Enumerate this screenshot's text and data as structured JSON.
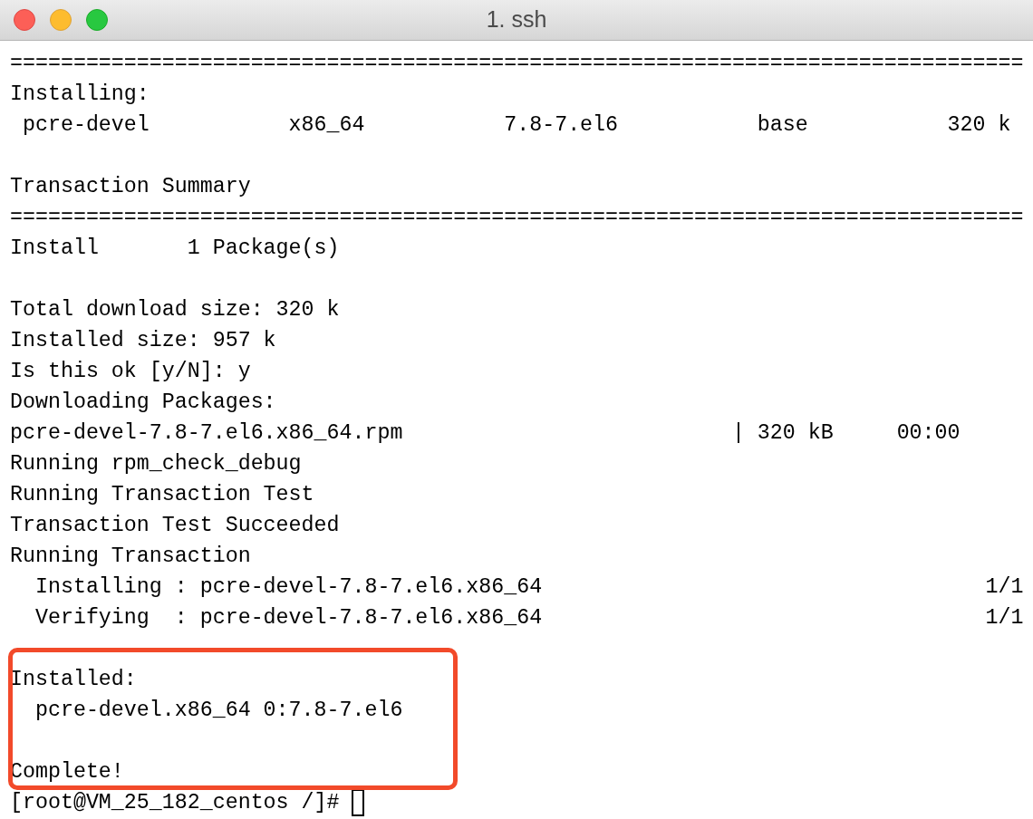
{
  "window": {
    "title": "1. ssh"
  },
  "terminal": {
    "lines": [
      {
        "kind": "text",
        "text": "================================================================================"
      },
      {
        "kind": "text",
        "text": "Installing:"
      },
      {
        "kind": "text",
        "text": " pcre-devel           x86_64           7.8-7.el6           base           320 k"
      },
      {
        "kind": "blank"
      },
      {
        "kind": "text",
        "text": "Transaction Summary"
      },
      {
        "kind": "text",
        "text": "================================================================================"
      },
      {
        "kind": "text",
        "text": "Install       1 Package(s)"
      },
      {
        "kind": "blank"
      },
      {
        "kind": "text",
        "text": "Total download size: 320 k"
      },
      {
        "kind": "text",
        "text": "Installed size: 957 k"
      },
      {
        "kind": "text",
        "text": "Is this ok [y/N]: y"
      },
      {
        "kind": "text",
        "text": "Downloading Packages:"
      },
      {
        "kind": "text",
        "text": "pcre-devel-7.8-7.el6.x86_64.rpm                          | 320 kB     00:00"
      },
      {
        "kind": "text",
        "text": "Running rpm_check_debug"
      },
      {
        "kind": "text",
        "text": "Running Transaction Test"
      },
      {
        "kind": "text",
        "text": "Transaction Test Succeeded"
      },
      {
        "kind": "text",
        "text": "Running Transaction"
      },
      {
        "kind": "text",
        "text": "  Installing : pcre-devel-7.8-7.el6.x86_64                                   1/1"
      },
      {
        "kind": "text",
        "text": "  Verifying  : pcre-devel-7.8-7.el6.x86_64                                   1/1"
      },
      {
        "kind": "blank"
      },
      {
        "kind": "text",
        "text": "Installed:",
        "highlighted": true
      },
      {
        "kind": "text",
        "text": "  pcre-devel.x86_64 0:7.8-7.el6",
        "highlighted": true
      },
      {
        "kind": "blank",
        "highlighted": true
      },
      {
        "kind": "text",
        "text": "Complete!",
        "highlighted": true
      },
      {
        "kind": "prompt",
        "text": "[root@VM_25_182_centos /]# "
      }
    ]
  }
}
